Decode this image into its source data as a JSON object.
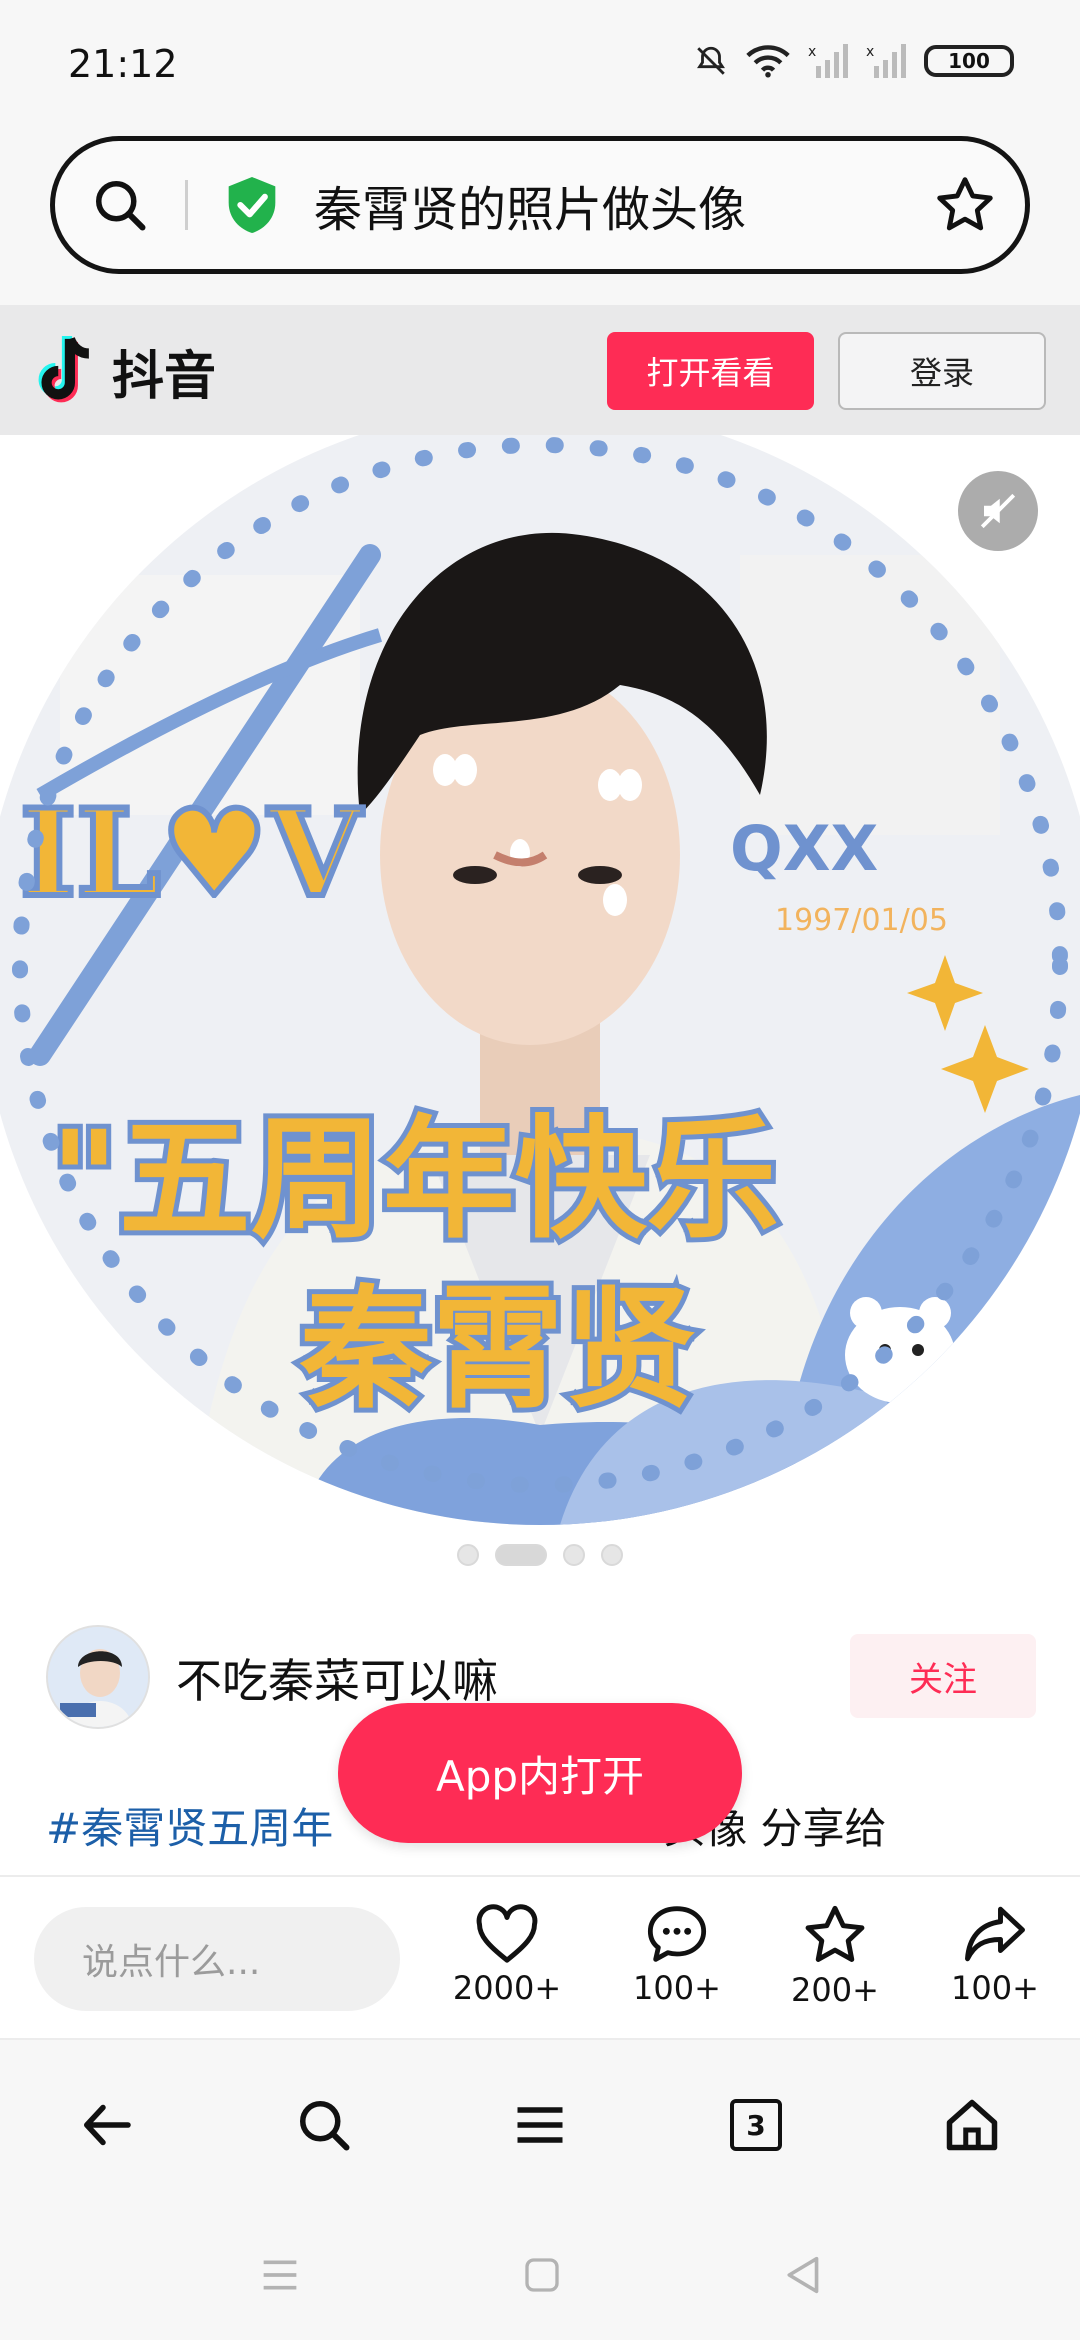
{
  "status_bar": {
    "time": "21:12",
    "battery": "100"
  },
  "browser": {
    "url_text": "秦霄贤的照片做头像"
  },
  "header": {
    "logo_text": "抖音",
    "open_button": "打开看看",
    "login_button": "登录"
  },
  "media": {
    "page_count": 4,
    "current_page": 2
  },
  "author": {
    "name": "不吃秦菜可以嘛",
    "follow_button": "关注"
  },
  "caption": {
    "hashtag": "#秦霄贤五周年",
    "text_visible": "头像 分享给"
  },
  "app_open_button": "App内打开",
  "actions": {
    "comment_placeholder": "说点什么...",
    "likes": "2000+",
    "comments": "100+",
    "favorites": "200+",
    "shares": "100+"
  },
  "browser_nav": {
    "tab_count": "3"
  },
  "colors": {
    "accent": "#fe2c55",
    "hashtag": "#1c5fa8"
  }
}
